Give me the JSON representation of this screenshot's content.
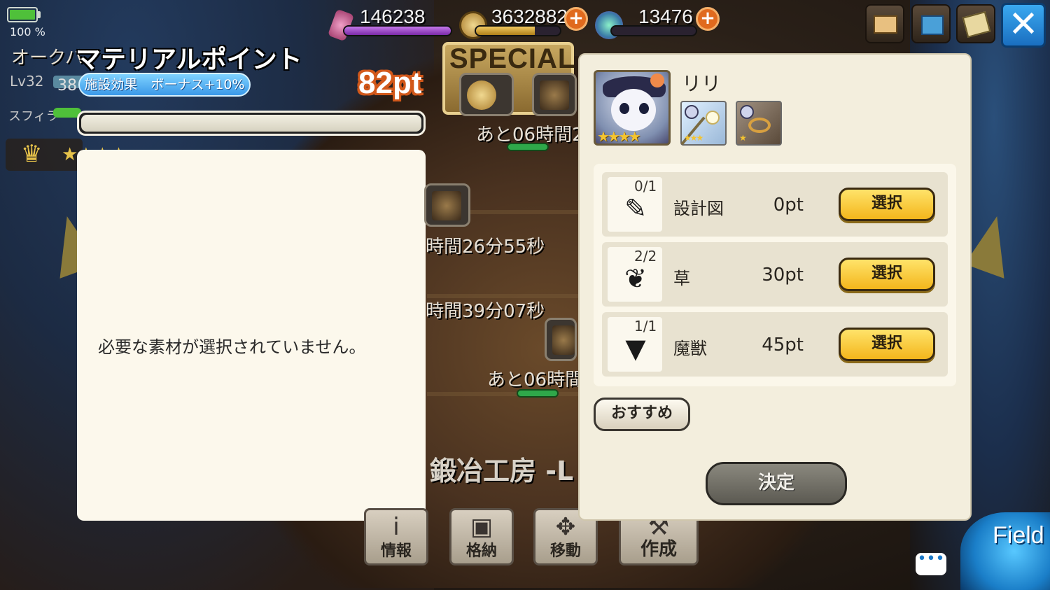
{
  "status": {
    "battery_pct": "100 %"
  },
  "currencies": {
    "crystal": "146238",
    "coins": "3632882",
    "gems": "13476",
    "plus": "+"
  },
  "top_buttons": {
    "close": "✕"
  },
  "facility": {
    "name": "オークハ",
    "lv": "Lv32",
    "lv_num": "38",
    "sphere": "スフィラ",
    "crown": "♛",
    "stars": "★★★★"
  },
  "material_point": {
    "title": "マテリアルポイント",
    "bonus": "施設効果　ボーナス+10%",
    "points": "82pt",
    "fill_fraction": 0
  },
  "message": {
    "text": "必要な素材が選択されていません。"
  },
  "scene": {
    "special": "SPECIAL",
    "timer_1": "あと06時間2",
    "timer_2": "時間26分55秒",
    "timer_3": "時間39分07秒",
    "timer_4": "あと06時間",
    "facility_label": "鍛冶工房 -L"
  },
  "bottom_menu": {
    "info": "情報",
    "storage": "格納",
    "move": "移動",
    "create": "作成",
    "field": "Field",
    "chat": "•••"
  },
  "dialog": {
    "character_name": "リリ",
    "character_stars": "★★★★",
    "equip1_stars": "★★★",
    "equip2_stars": "★",
    "materials": [
      {
        "count": "0/1",
        "icon": "blueprint-icon",
        "glyph": "📜",
        "name": "設計図",
        "pt": "0pt",
        "button": "選択"
      },
      {
        "count": "2/2",
        "icon": "grass-icon",
        "glyph": "🌿",
        "name": "草",
        "pt": "30pt",
        "button": "選択"
      },
      {
        "count": "1/1",
        "icon": "beast-icon",
        "glyph": "😈",
        "name": "魔獣",
        "pt": "45pt",
        "button": "選択"
      }
    ],
    "recommend": "おすすめ",
    "decide": "決定"
  },
  "colors": {
    "accent_select": "#f3b61c",
    "points_outline": "#d2581a",
    "bonus_pill": "#3a98e8",
    "close_button": "#1a6fc0"
  }
}
